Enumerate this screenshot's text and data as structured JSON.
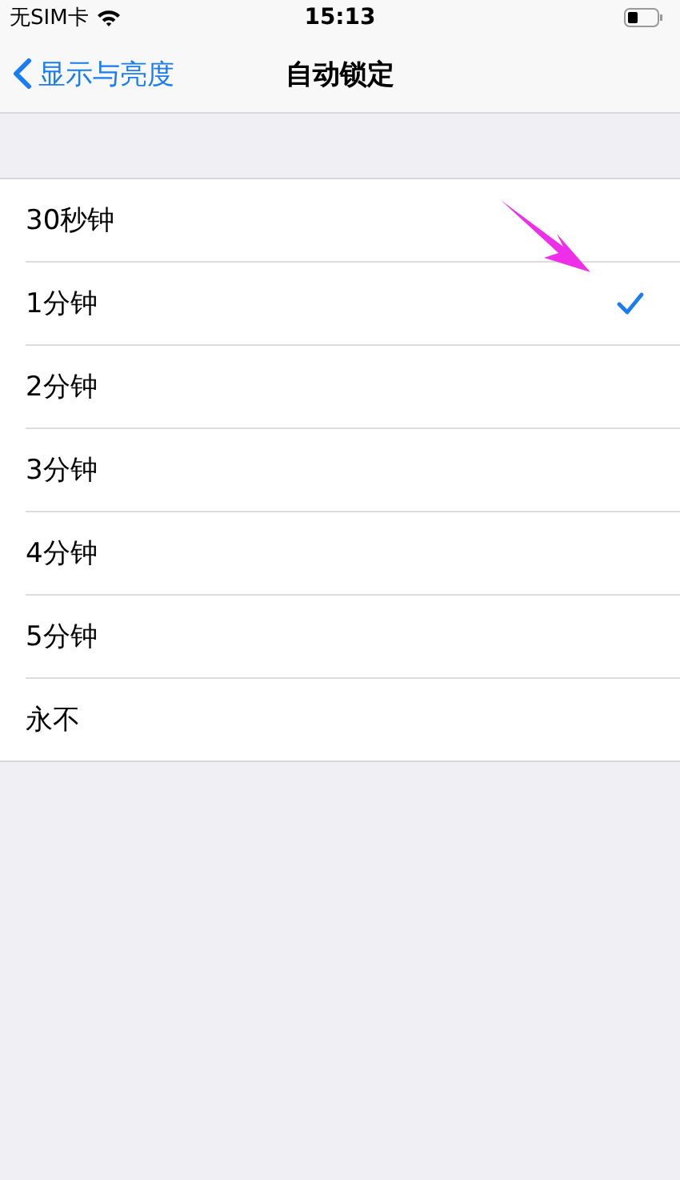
{
  "status_bar": {
    "carrier": "无SIM卡",
    "time": "15:13"
  },
  "nav": {
    "back": "显示与亮度",
    "title": "自动锁定"
  },
  "options": [
    {
      "label": "30秒钟",
      "selected": false
    },
    {
      "label": "1分钟",
      "selected": true
    },
    {
      "label": "2分钟",
      "selected": false
    },
    {
      "label": "3分钟",
      "selected": false
    },
    {
      "label": "4分钟",
      "selected": false
    },
    {
      "label": "5分钟",
      "selected": false
    },
    {
      "label": "永不",
      "selected": false
    }
  ]
}
